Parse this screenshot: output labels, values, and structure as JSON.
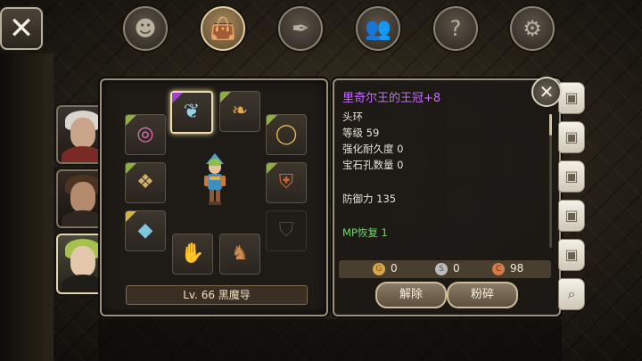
{
  "top_tabs": [
    {
      "icon": "head-icon",
      "glyph": "☻",
      "active": false
    },
    {
      "icon": "bag-icon",
      "glyph": "👜",
      "active": true
    },
    {
      "icon": "feather-icon",
      "glyph": "✒",
      "active": false
    },
    {
      "icon": "party-icon",
      "glyph": "👥",
      "active": false
    },
    {
      "icon": "quest-scroll-icon",
      "glyph": "?",
      "active": false
    },
    {
      "icon": "gear-icon",
      "glyph": "⚙",
      "active": false
    }
  ],
  "close_glyph": "✕",
  "equipment": {
    "level_label": "Lv. 66 黑魔导",
    "slots": [
      {
        "icon": "necklace-icon",
        "glyph": "❦",
        "corner": "#a33fd4",
        "selected": true,
        "empty": false
      },
      {
        "icon": "amulet-icon",
        "glyph": "❧",
        "corner": "#8ab03e",
        "selected": false,
        "empty": false
      },
      {
        "icon": "ring-icon",
        "glyph": "◎",
        "corner": "#8ab03e",
        "selected": false,
        "empty": false
      },
      {
        "icon": "bracelet-icon",
        "glyph": "◯",
        "corner": "#8ab03e",
        "selected": false,
        "empty": false
      },
      {
        "icon": "gauntlet-icon",
        "glyph": "❖",
        "corner": "#8ab03e",
        "selected": false,
        "empty": false
      },
      {
        "icon": "armor-icon",
        "glyph": "⛨",
        "corner": "#8ab03e",
        "selected": false,
        "empty": false
      },
      {
        "icon": "gem-icon",
        "glyph": "◆",
        "corner": "#d4b33f",
        "selected": false,
        "empty": false
      },
      {
        "icon": "shield-placeholder-icon",
        "glyph": "⛉",
        "corner": "",
        "selected": false,
        "empty": true
      },
      {
        "icon": "gloves-icon",
        "glyph": "✋",
        "corner": "",
        "selected": false,
        "empty": false
      },
      {
        "icon": "boots-icon",
        "glyph": "♞",
        "corner": "",
        "selected": false,
        "empty": false
      }
    ]
  },
  "item_info": {
    "title": "里奇尔王的王冠+8",
    "type": "头环",
    "level": "等级 59",
    "durability": "强化耐久度 0",
    "sockets": "宝石孔数量 0",
    "defense": "防御力 135",
    "mp": "MP恢复 1",
    "currency": [
      {
        "icon": "gold-coin-icon",
        "value": "0",
        "color": "#d7a64c"
      },
      {
        "icon": "silver-coin-icon",
        "value": "0",
        "color": "#bcbcbc"
      },
      {
        "icon": "copper-coin-icon",
        "value": "98",
        "color": "#d47a4b"
      }
    ],
    "buttons": {
      "disassemble": "解除",
      "smash": "粉碎"
    },
    "close_glyph": "✕"
  },
  "colors": {
    "item_title": "#c56bff",
    "mp_text": "#5fe05b",
    "panel_border": "#9a8f7a"
  }
}
